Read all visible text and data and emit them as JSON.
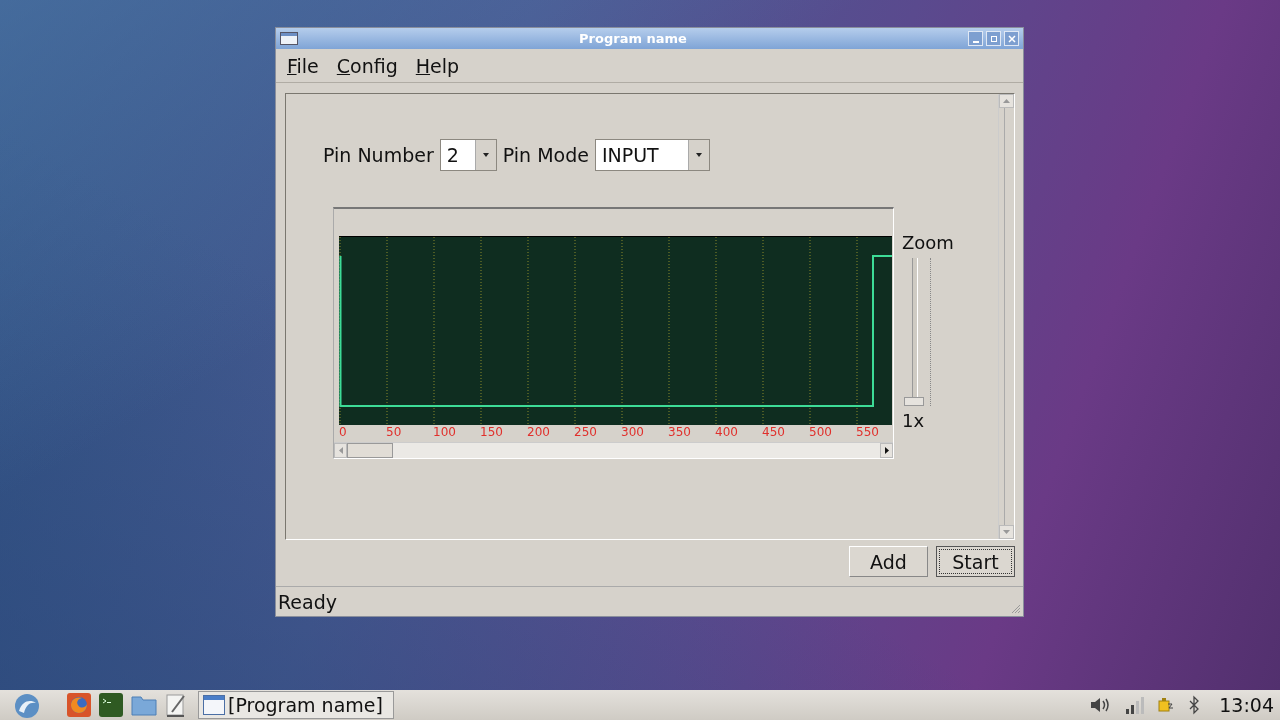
{
  "window": {
    "title": "Program name"
  },
  "menu": [
    {
      "label": "File"
    },
    {
      "label": "Config"
    },
    {
      "label": "Help"
    }
  ],
  "pin_number": {
    "label": "Pin Number",
    "value": "2"
  },
  "pin_mode": {
    "label": "Pin Mode",
    "value": "INPUT"
  },
  "plot": {
    "axis_labels": [
      "0",
      "50",
      "100",
      "150",
      "200",
      "250",
      "300",
      "350",
      "400",
      "450",
      "500",
      "550"
    ]
  },
  "zoom": {
    "label": "Zoom",
    "level": 0,
    "reading": "1x"
  },
  "buttons": [
    {
      "label": "Add",
      "focused": false
    },
    {
      "label": "Start",
      "focused": true
    }
  ],
  "status_bar": "Ready",
  "taskbar": {
    "task": "[Program name]",
    "clock": "13:04"
  }
}
